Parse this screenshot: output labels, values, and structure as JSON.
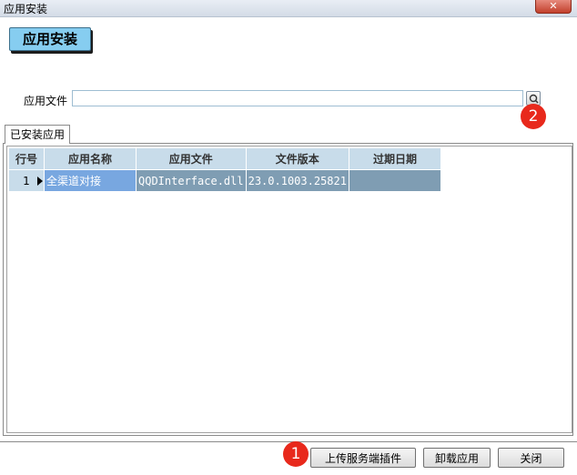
{
  "window": {
    "title": "应用安装",
    "close_symbol": "✕"
  },
  "header": {
    "title": "应用安装"
  },
  "file_field": {
    "label": "应用文件",
    "value": ""
  },
  "tabs": [
    {
      "label": "已安装应用",
      "active": true
    }
  ],
  "table": {
    "columns": [
      "行号",
      "应用名称",
      "应用文件",
      "文件版本",
      "过期日期"
    ],
    "rows": [
      {
        "row_no": "1",
        "app_name": "全渠道对接",
        "app_file": "QQDInterface.dll",
        "version": "23.0.1003.25821",
        "expiry": ""
      }
    ]
  },
  "buttons": {
    "upload": "上传服务端插件",
    "uninstall": "卸载应用",
    "close": "关闭"
  },
  "markers": {
    "one": "1",
    "two": "2"
  },
  "colors": {
    "header_badge": "#86cdf0",
    "marker": "#e8291c",
    "selected_cell": "#78a7e0",
    "row_cell": "#7f9db3",
    "grid_header": "#c8dcea"
  }
}
